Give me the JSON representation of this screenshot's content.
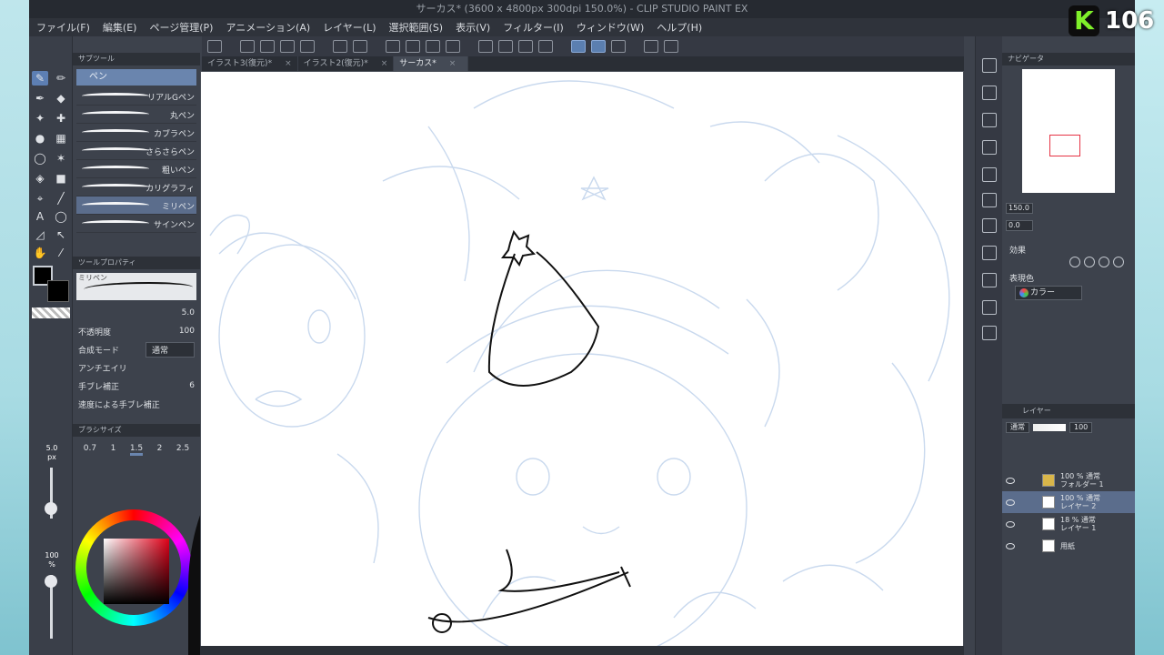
{
  "window": {
    "title": "サーカス* (3600 x 4800px 300dpi 150.0%) - CLIP STUDIO PAINT EX"
  },
  "menu": [
    "ファイル(F)",
    "編集(E)",
    "ページ管理(P)",
    "アニメーション(A)",
    "レイヤー(L)",
    "選択範囲(S)",
    "表示(V)",
    "フィルター(I)",
    "ウィンドウ(W)",
    "ヘルプ(H)"
  ],
  "tabs": [
    {
      "label": "イラスト3(復元)*",
      "close": "×"
    },
    {
      "label": "イラスト2(復元)*",
      "close": "×"
    },
    {
      "label": "サーカス*",
      "close": "×"
    }
  ],
  "subtool": {
    "header": "サブツール",
    "group": "ペン",
    "brushes": [
      "リアルGペン",
      "丸ペン",
      "カブラペン",
      "さらさらペン",
      "粗いペン",
      "カリグラフィ",
      "ミリペン",
      "サインペン"
    ],
    "selected": "ミリペン"
  },
  "tool_property": {
    "header": "ツールプロパティ",
    "preview_label": "ミリペン",
    "brush_size": "5.0",
    "opacity_label": "不透明度",
    "opacity_value": "100",
    "blend_label": "合成モード",
    "blend_value": "通常",
    "aa_label": "アンチエイリ",
    "stabilization_label": "手ブレ補正",
    "stabilization_value": "6",
    "speed_stab_label": "速度による手ブレ補正"
  },
  "brush_size_panel": {
    "header": "ブラシサイズ",
    "options": [
      "0.7",
      "1",
      "1.5",
      "2",
      "2.5"
    ],
    "selected": "1.5"
  },
  "left_sliders": {
    "size": "5.0",
    "size_unit": "px",
    "opacity": "100",
    "opacity_unit": "%"
  },
  "colors": {
    "main": "#000000",
    "sub": "#000000",
    "accent": "#5b7fb0"
  },
  "navigator": {
    "header": "ナビゲータ",
    "zoom": "150.0",
    "rotation": "0.0"
  },
  "effects": {
    "title": "効果",
    "expression_label": "表現色",
    "expression_value": "カラー"
  },
  "layers_panel": {
    "header": "レイヤー",
    "blend": "通常",
    "opacity": "100",
    "layers": [
      {
        "mode": "100 % 通常",
        "name": "フォルダー 1"
      },
      {
        "mode": "100 % 通常",
        "name": "レイヤー 2"
      },
      {
        "mode": "18 % 通常",
        "name": "レイヤー 1"
      },
      {
        "mode": "",
        "name": "用紙"
      }
    ]
  },
  "badge": {
    "letter": "K",
    "number": "106"
  }
}
